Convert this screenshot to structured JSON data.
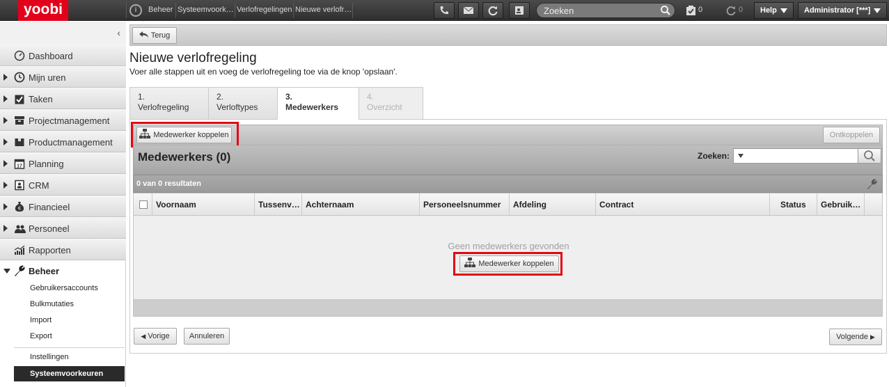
{
  "app": {
    "logo": "yoobi"
  },
  "breadcrumb": [
    {
      "label": "Beheer"
    },
    {
      "label": "Systeemvoork…"
    },
    {
      "label": "Verlofregelingen"
    },
    {
      "label": "Nieuwe verlofr…"
    }
  ],
  "topbar": {
    "search_placeholder": "Zoeken",
    "tasks_count": "0",
    "sync_count": "0",
    "help_label": "Help",
    "user_label": "Administrator [***]"
  },
  "sidebar": {
    "collapse_icon": "chevron-left-icon",
    "items": [
      {
        "label": "Dashboard",
        "icon": "dashboard-icon"
      },
      {
        "label": "Mijn uren",
        "icon": "clock-icon"
      },
      {
        "label": "Taken",
        "icon": "clipboard-icon"
      },
      {
        "label": "Projectmanagement",
        "icon": "folder-icon"
      },
      {
        "label": "Productmanagement",
        "icon": "box-icon"
      },
      {
        "label": "Planning",
        "icon": "calendar-icon"
      },
      {
        "label": "CRM",
        "icon": "contact-card-icon"
      },
      {
        "label": "Financieel",
        "icon": "money-bag-icon"
      },
      {
        "label": "Personeel",
        "icon": "people-icon"
      },
      {
        "label": "Rapporten",
        "icon": "chart-icon"
      }
    ],
    "beheer": {
      "label": "Beheer",
      "icon": "wrench-icon"
    },
    "sub_items": [
      {
        "label": "Gebruikersaccounts"
      },
      {
        "label": "Bulkmutaties"
      },
      {
        "label": "Import"
      },
      {
        "label": "Export"
      }
    ],
    "settings_items": [
      {
        "label": "Instellingen"
      },
      {
        "label": "Systeemvoorkeuren"
      }
    ]
  },
  "toolbar": {
    "back_label": "Terug"
  },
  "page": {
    "title": "Nieuwe verlofregeling",
    "subtitle": "Voer alle stappen uit en voeg de verlofregeling toe via de knop 'opslaan'."
  },
  "steps": [
    {
      "num": "1.",
      "label": "Verlofregeling"
    },
    {
      "num": "2.",
      "label": "Verloftypes"
    },
    {
      "num": "3.",
      "label": "Medewerkers"
    },
    {
      "num": "4.",
      "label": "Overzicht"
    }
  ],
  "grid": {
    "link_label": "Medewerker koppelen",
    "unlink_label": "Ontkoppelen",
    "title": "Medewerkers (0)",
    "search_label": "Zoeken:",
    "results": "0 van 0 resultaten",
    "columns": [
      "Voornaam",
      "Tussenv…",
      "Achternaam",
      "Personeelsnummer",
      "Afdeling",
      "Contract",
      "Status",
      "Gebruik…"
    ],
    "empty_text": "Geen medewerkers gevonden",
    "empty_button": "Medewerker koppelen"
  },
  "footer": {
    "prev_label": "Vorige",
    "cancel_label": "Annuleren",
    "next_label": "Volgende"
  },
  "colors": {
    "brand": "#e2001a",
    "highlight": "#e30613"
  }
}
